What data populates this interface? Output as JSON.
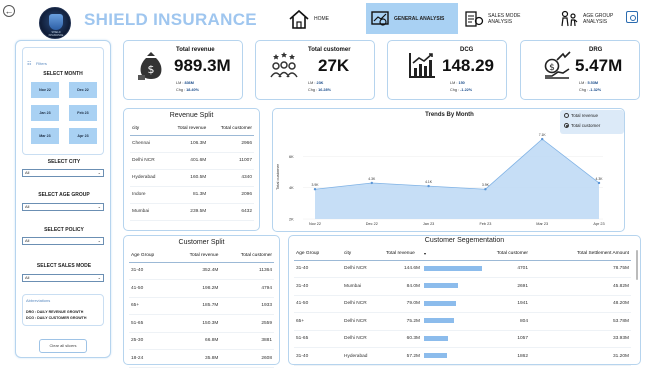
{
  "header": {
    "title": "SHIELD INSURANCE",
    "logo_text": "SHIELD INSURANCE",
    "nav": [
      {
        "label": "HOME",
        "icon": "home-icon",
        "active": false
      },
      {
        "label": "GENERAL ANALYSIS",
        "icon": "analysis-icon",
        "active": true
      },
      {
        "label": "SALES MODE ANALYSIS",
        "icon": "sales-mode-icon",
        "active": false
      },
      {
        "label": "AGE GROUP ANALYSIS",
        "icon": "age-group-icon",
        "active": false
      }
    ]
  },
  "sidebar": {
    "filters_label": "Filters",
    "select_month_title": "SELECT MONTH",
    "months": [
      "Nov 22",
      "Dec 22",
      "Jan 23",
      "Feb 23",
      "Mar 23",
      "Apr 23"
    ],
    "dropdowns": [
      {
        "title": "SELECT CITY",
        "value": "All"
      },
      {
        "title": "SELECT AGE GROUP",
        "value": "All"
      },
      {
        "title": "SELECT POLICY",
        "value": "All"
      },
      {
        "title": "SELECT SALES MODE",
        "value": "All"
      }
    ],
    "abbreviations_title": "Abbreviations",
    "abbreviations": [
      "DRG : DAILY REVENUE GROWTH",
      "DCG : DAILY CUSTOMER GROWTH"
    ],
    "clear_button": "Clear all slicers"
  },
  "kpis": [
    {
      "label": "Total revenue",
      "value": "989.3M",
      "ly_label": "LM :",
      "ly": "836M",
      "chg_label": "Chg :",
      "chg": "18.40%",
      "icon": "money-bag-icon"
    },
    {
      "label": "Total customer",
      "value": "27K",
      "ly_label": "LM :",
      "ly": "23K",
      "chg_label": "Chg :",
      "chg": "16.28%",
      "icon": "customers-icon"
    },
    {
      "label": "DCG",
      "value": "148.29",
      "ly_label": "LM :",
      "ly": "150",
      "chg_label": "Chg :",
      "chg": "-1.22%",
      "icon": "growth-chart-icon"
    },
    {
      "label": "DRG",
      "value": "5.47M",
      "ly_label": "LM :",
      "ly": "5.53M",
      "chg_label": "Chg :",
      "chg": "-1.32%",
      "icon": "money-growth-icon"
    }
  ],
  "revenue_split": {
    "title": "Revenue Split",
    "columns": [
      "city",
      "Total revenue",
      "Total customer"
    ],
    "rows": [
      [
        "Chennai",
        "106.3M",
        "2966"
      ],
      [
        "Delhi NCR",
        "401.6M",
        "11007"
      ],
      [
        "Hyderabad",
        "160.5M",
        "4340"
      ],
      [
        "Indore",
        "81.3M",
        "2096"
      ],
      [
        "Mumbai",
        "239.5M",
        "6432"
      ]
    ]
  },
  "trend_chart": {
    "title": "Trends By Month",
    "legend": [
      {
        "label": "Total revenue",
        "selected": false
      },
      {
        "label": "Total customer",
        "selected": true
      }
    ],
    "y_ticks": [
      "6K",
      "4K",
      "2K"
    ],
    "ylabel": "Total customer"
  },
  "chart_data": {
    "type": "area",
    "title": "Trends By Month",
    "ylabel": "Total customer",
    "categories": [
      "Nov 22",
      "Dec 22",
      "Jan 23",
      "Feb 23",
      "Mar 23",
      "Apr 23"
    ],
    "series": [
      {
        "name": "Total customer",
        "values": [
          3.9,
          4.3,
          4.1,
          3.9,
          7.1,
          4.3
        ],
        "labels": [
          "3.9K",
          "4.3K",
          "4.1K",
          "3.9K",
          "7.1K",
          "4.3K"
        ]
      }
    ],
    "ylim": [
      2,
      8
    ],
    "y_ticks": [
      6,
      4,
      2
    ]
  },
  "customer_split": {
    "title": "Customer Split",
    "columns": [
      "Age Group",
      "Total revenue",
      "Total customer"
    ],
    "rows": [
      [
        "31-40",
        "352.4M",
        "11364"
      ],
      [
        "41-50",
        "198.2M",
        "4794"
      ],
      [
        "65+",
        "185.7M",
        "1933"
      ],
      [
        "51-65",
        "150.3M",
        "2559"
      ],
      [
        "25-30",
        "66.8M",
        "3881"
      ],
      [
        "18-24",
        "35.8M",
        "2608"
      ]
    ]
  },
  "customer_segmentation": {
    "title": "Customer Segementation",
    "columns": [
      "Age Group",
      "city",
      "Total revenue",
      "",
      "Total customer",
      "Total Settlement Amount"
    ],
    "rows": [
      {
        "age": "31-40",
        "city": "Delhi NCR",
        "revenue": "144.6M",
        "bar": 1.0,
        "customers": "4701",
        "settlement": "78.75M"
      },
      {
        "age": "31-40",
        "city": "Mumbai",
        "revenue": "84.0M",
        "bar": 0.58,
        "customers": "2691",
        "settlement": "45.82M"
      },
      {
        "age": "41-50",
        "city": "Delhi NCR",
        "revenue": "79.0M",
        "bar": 0.55,
        "customers": "1941",
        "settlement": "48.20M"
      },
      {
        "age": "65+",
        "city": "Delhi NCR",
        "revenue": "75.2M",
        "bar": 0.52,
        "customers": "804",
        "settlement": "53.78M"
      },
      {
        "age": "51-65",
        "city": "Delhi NCR",
        "revenue": "60.3M",
        "bar": 0.42,
        "customers": "1057",
        "settlement": "33.93M"
      },
      {
        "age": "31-40",
        "city": "Hyderabad",
        "revenue": "57.2M",
        "bar": 0.4,
        "customers": "1862",
        "settlement": "31.20M"
      }
    ]
  }
}
